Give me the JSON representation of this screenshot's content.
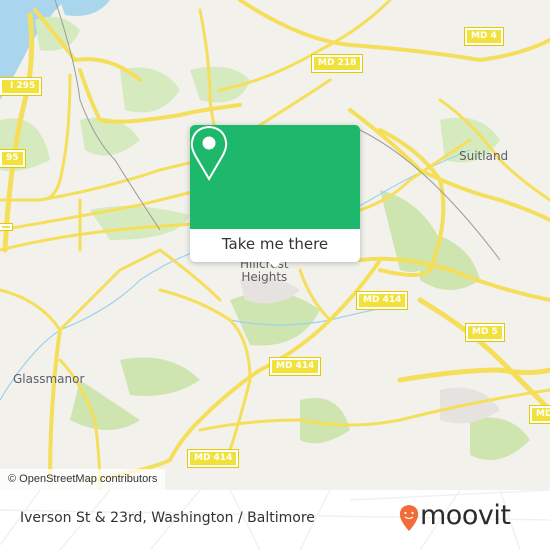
{
  "map": {
    "place_labels": {
      "suitland": "Suitland",
      "hillcrest_heights_line1": "Hillcrest",
      "hillcrest_heights_line2": "Heights",
      "glassmanor": "Glassmanor"
    },
    "road_shields": {
      "md4": "MD 4",
      "md218": "MD 218",
      "i295_top": "I 295",
      "i295_left": "95",
      "md414_east": "MD 414",
      "md414_middle": "MD 414",
      "md414_south": "MD 414",
      "md5": "MD 5",
      "md_partial": "MD"
    },
    "attribution": "© OpenStreetMap contributors",
    "colors": {
      "land": "#f2f1ec",
      "park": "#cfe5b0",
      "water": "#9fd2ea",
      "road": "#f5df5a",
      "rail": "#9a9a9a"
    }
  },
  "popup": {
    "button_label": "Take me there",
    "icon": "map-pin-icon",
    "color": "#1db86b"
  },
  "footer": {
    "title": "Iverson St & 23rd, Washington / Baltimore",
    "brand": "moovit",
    "brand_color": "#f26b3a"
  }
}
